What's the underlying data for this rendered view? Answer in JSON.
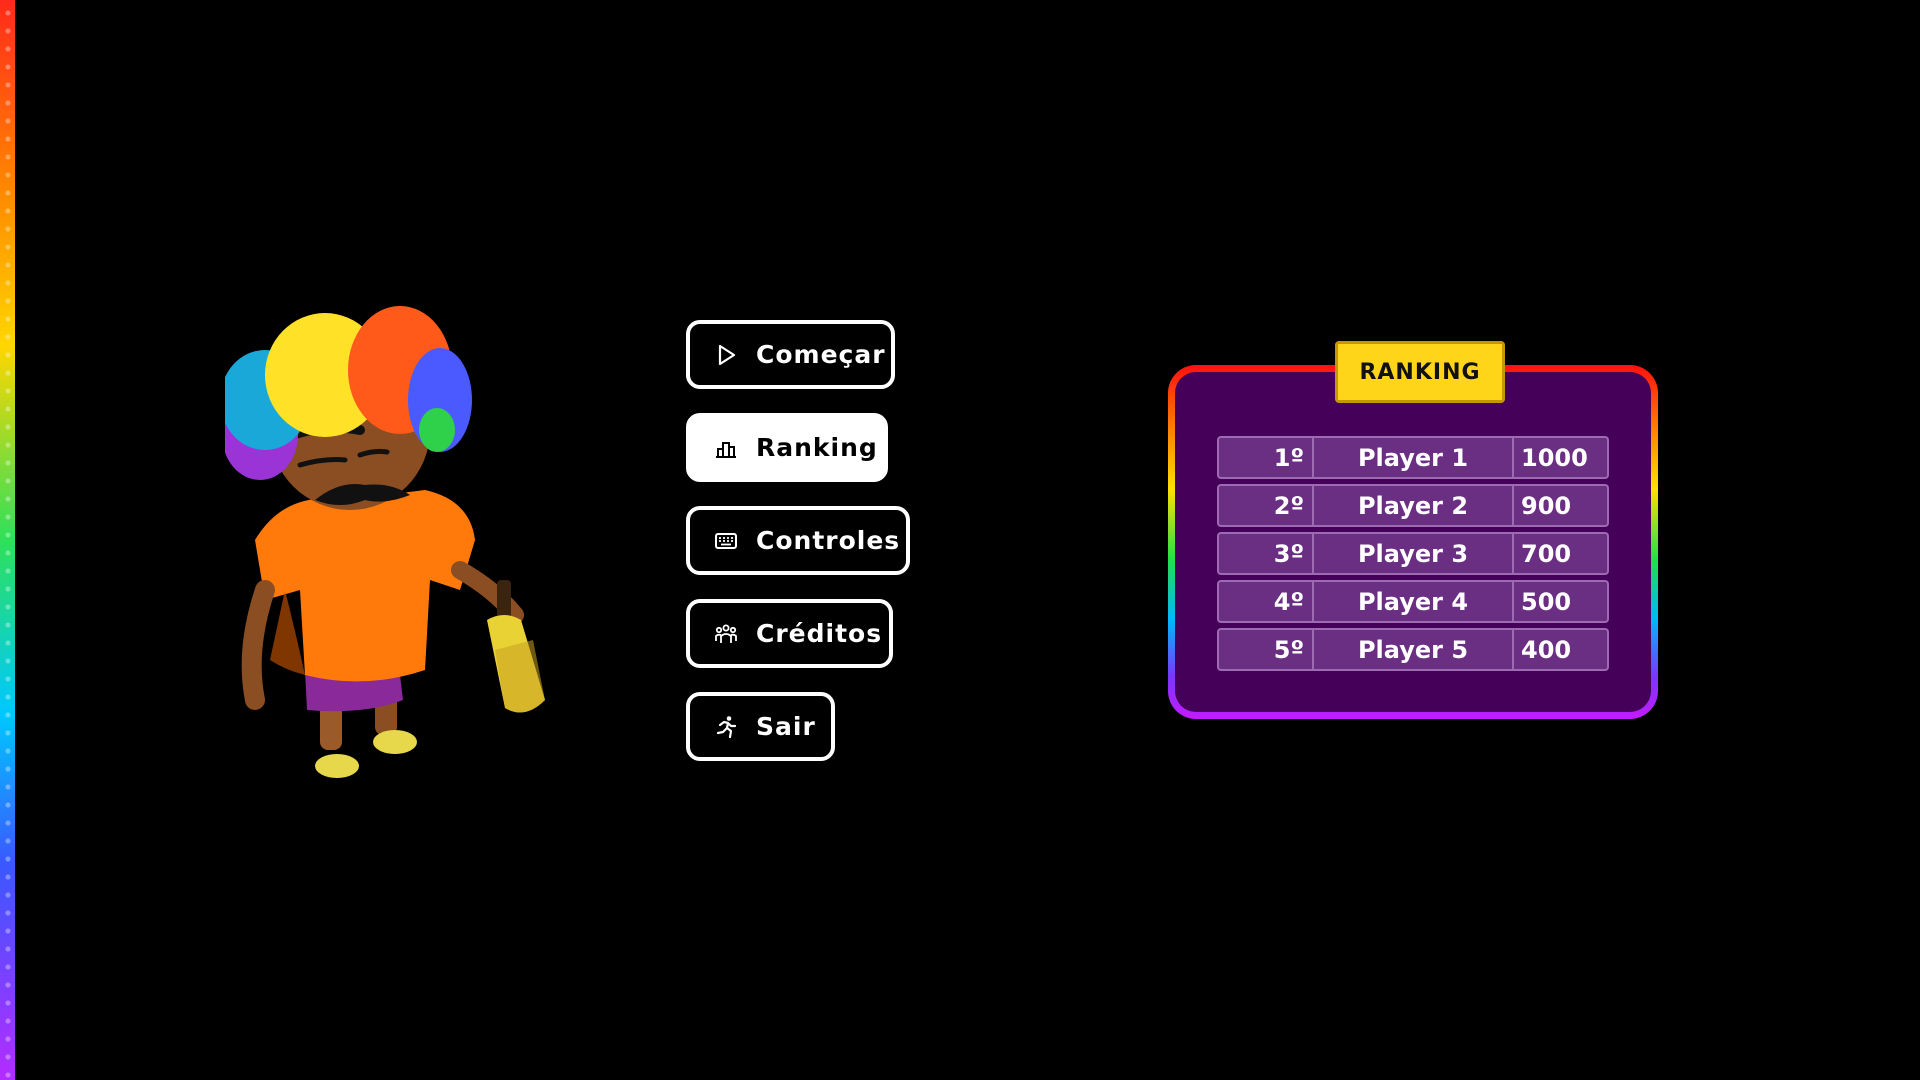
{
  "menu": {
    "items": [
      {
        "id": "start",
        "label": "Começar",
        "icon": "play-icon"
      },
      {
        "id": "ranking",
        "label": "Ranking",
        "icon": "podium-icon",
        "active": true
      },
      {
        "id": "controls",
        "label": "Controles",
        "icon": "keyboard-icon"
      },
      {
        "id": "credits",
        "label": "Créditos",
        "icon": "people-icon"
      },
      {
        "id": "exit",
        "label": "Sair",
        "icon": "running-person-icon"
      }
    ]
  },
  "ranking": {
    "title": "RANKING",
    "rows": [
      {
        "rank": "1º",
        "name": "Player 1",
        "score": "1000"
      },
      {
        "rank": "2º",
        "name": "Player 2",
        "score": "900"
      },
      {
        "rank": "3º",
        "name": "Player 3",
        "score": "700"
      },
      {
        "rank": "4º",
        "name": "Player 4",
        "score": "500"
      },
      {
        "rank": "5º",
        "name": "Player 5",
        "score": "400"
      }
    ]
  },
  "colors": {
    "background": "#000000",
    "panel": "#45005a",
    "row": "#6a2e83",
    "title_badge": "#ffd51a"
  }
}
